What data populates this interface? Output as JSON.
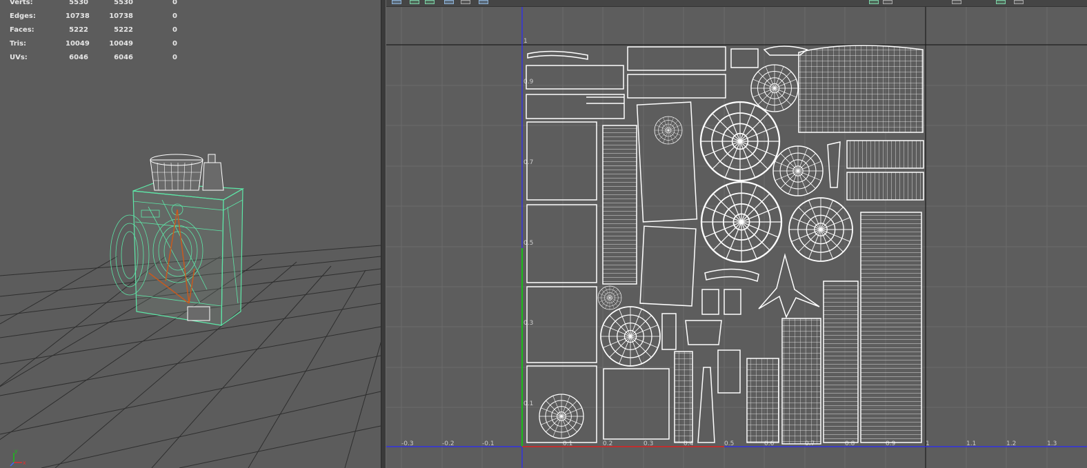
{
  "hud": {
    "rows": [
      {
        "label": "Verts:",
        "v1": "5530",
        "v2": "5530",
        "v3": "0"
      },
      {
        "label": "Edges:",
        "v1": "10738",
        "v2": "10738",
        "v3": "0"
      },
      {
        "label": "Faces:",
        "v1": "5222",
        "v2": "5222",
        "v3": "0"
      },
      {
        "label": "Tris:",
        "v1": "10049",
        "v2": "10049",
        "v3": "0"
      },
      {
        "label": "UVs:",
        "v1": "6046",
        "v2": "6046",
        "v3": "0"
      }
    ]
  },
  "uv_editor": {
    "u_ticks": [
      "-0.3",
      "-0.2",
      "-0.1",
      "0.1",
      "0.2",
      "0.3",
      "0.4",
      "0.5",
      "0.6",
      "0.7",
      "0.8",
      "0.9",
      "1",
      "1.1",
      "1.2",
      "1.3"
    ],
    "v_ticks": [
      "1",
      "0.9",
      "0.7",
      "0.5",
      "0.3",
      "0.1"
    ]
  },
  "axis_gizmo": {
    "x": "x",
    "y": "y"
  },
  "colors": {
    "selection": "#5de8a8",
    "wire": "#ffffff",
    "u_axis": "#2a2aff",
    "v_axis": "#18c018",
    "pivot": "#c85a1e"
  },
  "icons": {
    "toolbar": [
      "uv-select-icon",
      "uv-shell-icon",
      "uv-grid-icon",
      "uv-frame-icon",
      "uv-texture-icon",
      "uv-image-icon"
    ]
  }
}
